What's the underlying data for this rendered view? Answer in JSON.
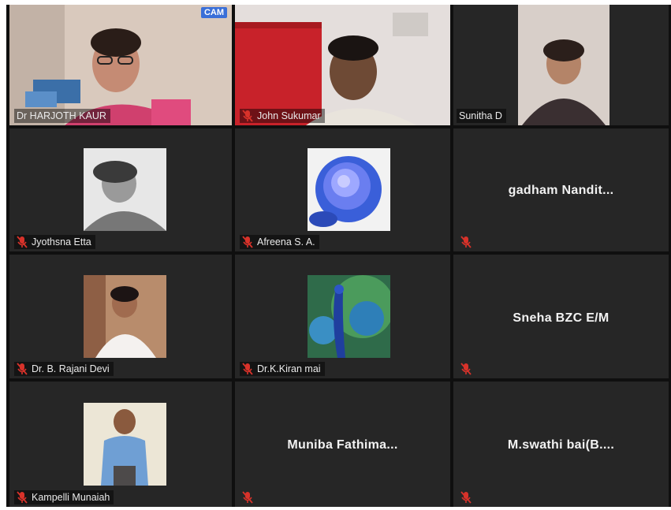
{
  "window": {
    "badge": "CAM"
  },
  "participants": [
    {
      "name": "Dr HARJOTH KAUR",
      "muted": false,
      "type": "video",
      "active": true
    },
    {
      "name": "John Sukumar",
      "muted": true,
      "type": "video"
    },
    {
      "name": "Sunitha D",
      "muted": false,
      "type": "video"
    },
    {
      "name": "Jyothsna Etta",
      "muted": true,
      "type": "photo"
    },
    {
      "name": "Afreena S. A.",
      "muted": true,
      "type": "photo"
    },
    {
      "name": "gadham Nandit...",
      "muted": true,
      "type": "name-only"
    },
    {
      "name": "Dr. B. Rajani Devi",
      "muted": true,
      "type": "photo"
    },
    {
      "name": "Dr.K.Kiran mai",
      "muted": true,
      "type": "photo"
    },
    {
      "name": "Sneha BZC E/M",
      "muted": true,
      "type": "name-only"
    },
    {
      "name": "Kampelli Munaiah",
      "muted": true,
      "type": "photo"
    },
    {
      "name": "Muniba Fathima...",
      "muted": true,
      "type": "name-only"
    },
    {
      "name": "M.swathi bai(B....",
      "muted": true,
      "type": "name-only"
    }
  ],
  "colors": {
    "tile_bg": "#262626",
    "grid_bg": "#0f0f0f",
    "mute_red": "#d8322a",
    "active_border": "#c9d21b"
  }
}
